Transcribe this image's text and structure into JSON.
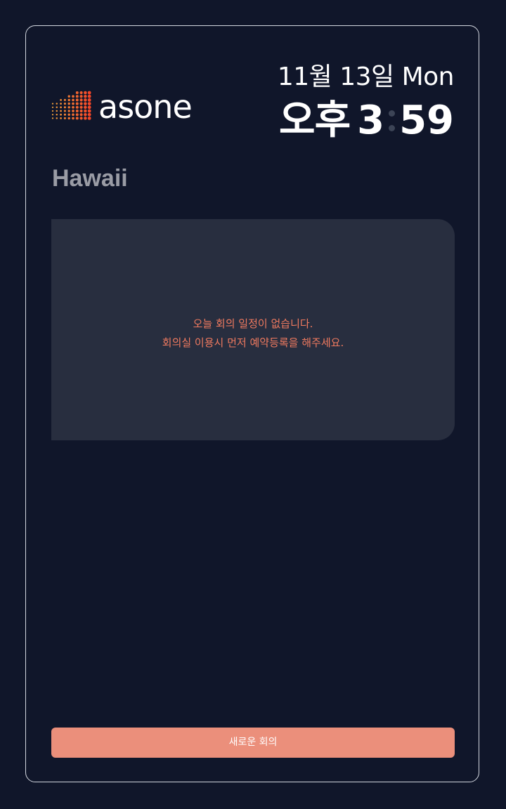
{
  "header": {
    "logo_text": "asone",
    "date": "11월 13일 Mon",
    "time": {
      "period": "오후",
      "hour": "3",
      "minute": "59"
    }
  },
  "room": {
    "name": "Hawaii"
  },
  "schedule": {
    "empty_line_1": "오늘 회의 일정이 없습니다.",
    "empty_line_2": "회의실 이용시 먼저 예약등록을 해주세요."
  },
  "actions": {
    "new_meeting_label": "새로운 회의"
  },
  "colors": {
    "background": "#10162a",
    "panel": "#282e3f",
    "accent": "#eb8f7b",
    "empty_text": "#f07a5f",
    "room_name": "#9a9ca5"
  }
}
